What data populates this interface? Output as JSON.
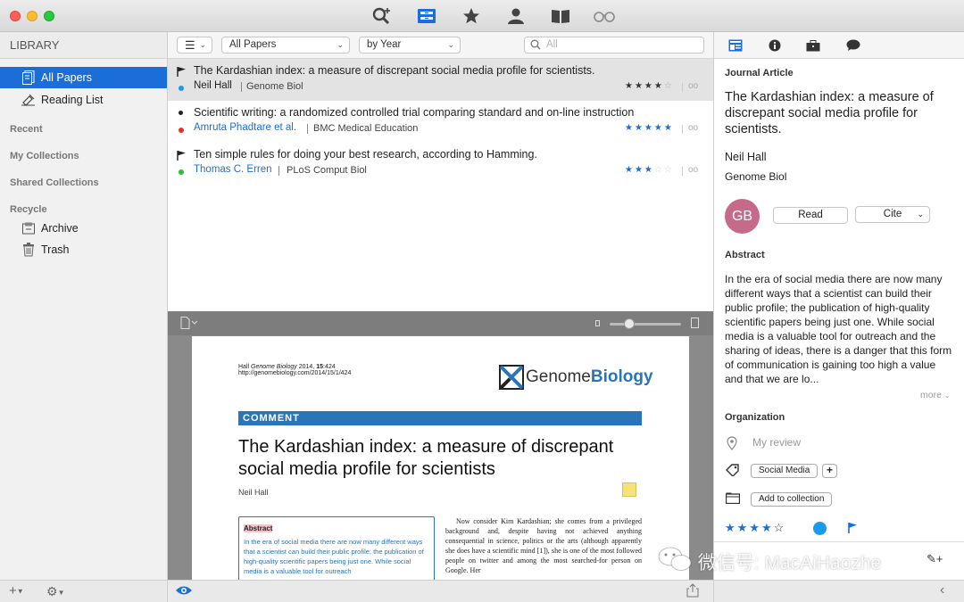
{
  "sidebar": {
    "header": "LIBRARY",
    "items": [
      {
        "label": "All Papers"
      },
      {
        "label": "Reading List"
      },
      {
        "label": "Archive"
      },
      {
        "label": "Trash"
      }
    ],
    "groups": [
      "Recent",
      "My Collections",
      "Shared Collections",
      "Recycle"
    ]
  },
  "toolbar": {
    "all_papers": "All Papers",
    "by_year": "by Year",
    "search_placeholder": "All"
  },
  "papers": [
    {
      "title": "The Kardashian index: a measure of discrepant social media profile for scientists.",
      "author": "Neil Hall",
      "journal": "Genome Biol",
      "author_color": "#222222",
      "dot_color": "#1a9bea",
      "stars": 4
    },
    {
      "title": "Scientific writing: a randomized controlled trial comparing standard and on-line instruction",
      "author": "Amruta Phadtare et al.",
      "journal": "BMC Medical Education",
      "author_color": "#1b6ed8",
      "dot_color": "#e8302a",
      "stars": 5
    },
    {
      "title": "Ten simple rules for doing your best research, according to Hamming.",
      "author": "Thomas C. Erren",
      "journal": "PLoS Comput Biol",
      "author_color": "#1b6ed8",
      "dot_color": "#2dbf2d",
      "stars": 3
    }
  ],
  "pdf": {
    "citation_line1_prefix": "Hall ",
    "citation_journal": "Genome Biology",
    "citation_year_vol": " 2014, ",
    "citation_vol": "15",
    "citation_page": ":424",
    "citation_url": "http://genomebiology.com/2014/15/1/424",
    "logo_genome": "Genome",
    "logo_biology": "Biology",
    "banner": "COMMENT",
    "heading": "The Kardashian index: a measure of discrepant social media profile for scientists",
    "author": "Neil Hall",
    "abstract_label": "Abstract",
    "abstract_text": "In the era of social media there are now many different ways that a scientist can build their public profile; the publication of high-quality scientific papers being just one. While social media is a valuable tool for outreach",
    "body_text": "Now consider Kim Kardashian; she comes from a privileged background and, despite having not achieved anything consequential in science, politics or the arts (although apparently she does have a scientific mind [1]), she is one of the most followed people on twitter and among the most searched-for person on Google. Her"
  },
  "detail": {
    "type_label": "Journal Article",
    "title": "The Kardashian index: a measure of discrepant social media profile for scientists.",
    "author": "Neil Hall",
    "journal": "Genome Biol",
    "avatar_initials": "GB",
    "read_label": "Read",
    "cite_label": "Cite",
    "abstract_heading": "Abstract",
    "abstract": "In the era of social media there are now many different ways that a scientist can build their public profile; the publication of high-quality scientific papers being just one. While social media is a valuable tool for outreach and the sharing of ideas, there is a danger that this form of communication is gaining too high a value and that we are lo...",
    "more_label": "more",
    "organization_heading": "Organization",
    "my_review_placeholder": "My review",
    "tag_chip": "Social Media",
    "add_collection": "Add to collection",
    "stars": 4,
    "color_dot": "#1a9bea"
  },
  "watermark": "微信号: MacAiHaozhe",
  "colors": {
    "accent": "#1b6ed8",
    "banner": "#2a74b8"
  }
}
